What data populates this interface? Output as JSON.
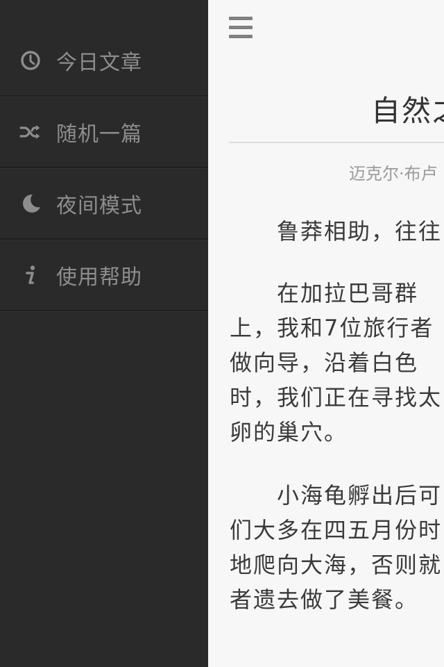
{
  "sidebar": {
    "items": [
      {
        "label": "今日文章",
        "icon": "clock-icon"
      },
      {
        "label": "随机一篇",
        "icon": "shuffle-icon"
      },
      {
        "label": "夜间模式",
        "icon": "moon-icon"
      },
      {
        "label": "使用帮助",
        "icon": "info-icon"
      }
    ]
  },
  "main": {
    "menu_icon": "hamburger-menu-icon",
    "title": "自然之",
    "author": "迈克尔·布卢",
    "paragraphs": [
      "　　鲁莽相助，往往",
      "　　在加拉巴哥群\n上，我和7位旅行者\n做向导，沿着白色\n时，我们正在寻找太\n卵的巢穴。",
      "　　小海龟孵出后可\n们大多在四五月份时\n地爬向大海，否则就\n者遗去做了美餐。"
    ]
  },
  "colors": {
    "sidebar_bg": "#2a2a2a",
    "sidebar_text": "#8d8d8d",
    "content_bg": "#f7f7f7",
    "body_text": "#3a3a3a"
  }
}
